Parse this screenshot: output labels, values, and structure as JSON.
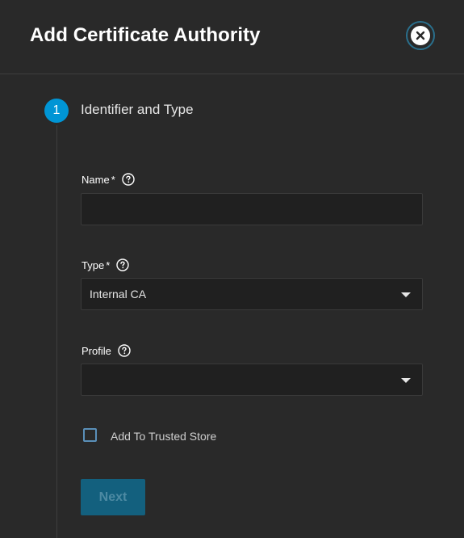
{
  "dialog": {
    "title": "Add Certificate Authority"
  },
  "stepper": {
    "step_number": "1",
    "step_label": "Identifier and Type"
  },
  "form": {
    "name": {
      "label": "Name",
      "required_mark": "*",
      "value": ""
    },
    "type": {
      "label": "Type",
      "required_mark": "*",
      "selected": "Internal CA"
    },
    "profile": {
      "label": "Profile",
      "selected": ""
    },
    "trusted_store": {
      "label": "Add To Trusted Store",
      "checked": false
    },
    "next_label": "Next"
  },
  "icons": {
    "close": "close-icon",
    "help": "help-circle-icon",
    "dropdown": "chevron-down-icon"
  },
  "colors": {
    "background": "#292929",
    "accent": "#0095d5",
    "button_disabled_bg": "#13607e",
    "input_bg": "#202020"
  }
}
